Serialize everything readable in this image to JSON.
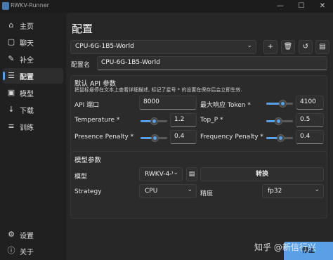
{
  "window": {
    "title": "RWKV-Runner",
    "controls": {
      "minimize": "—",
      "maximize": "☐",
      "close": "✕"
    }
  },
  "sidebar": {
    "items": [
      {
        "label": "主页",
        "icon": "home-icon",
        "glyph": "⌂"
      },
      {
        "label": "聊天",
        "icon": "chat-icon",
        "glyph": "▢"
      },
      {
        "label": "补全",
        "icon": "document-edit-icon",
        "glyph": "✎"
      },
      {
        "label": "配置",
        "icon": "sliders-icon",
        "glyph": "☰",
        "active": true
      },
      {
        "label": "模型",
        "icon": "model-icon",
        "glyph": "▣"
      },
      {
        "label": "下载",
        "icon": "download-icon",
        "glyph": "↓"
      },
      {
        "label": "训练",
        "icon": "training-icon",
        "glyph": "≡"
      }
    ],
    "bottom": [
      {
        "label": "设置",
        "icon": "gear-icon",
        "glyph": "⚙"
      },
      {
        "label": "关于",
        "icon": "info-icon",
        "glyph": "ⓘ"
      }
    ]
  },
  "page": {
    "title": "配置",
    "preset": "CPU-6G-1B5-World",
    "toolbar": {
      "add": "+",
      "delete": "🗑",
      "reset": "↺",
      "save": "▤"
    },
    "config_name_label": "配置名",
    "config_name_value": "CPU-6G-1B5-World"
  },
  "api": {
    "title": "默认 API 参数",
    "description": "把鼠标悬停在文本上查看详细描述, 标记了星号 * 的设置在保存后会立即生效.",
    "port": {
      "label": "API 端口",
      "value": "8000"
    },
    "max_tokens": {
      "label": "最大响应 Token *",
      "value": "4100",
      "fraction": 0.62
    },
    "temperature": {
      "label": "Temperature *",
      "value": "1.2",
      "fraction": 0.5
    },
    "top_p": {
      "label": "Top_P *",
      "value": "0.5",
      "fraction": 0.45
    },
    "presence_penalty": {
      "label": "Presence Penalty *",
      "value": "0.4",
      "fraction": 0.55
    },
    "frequency_penalty": {
      "label": "Frequency Penalty *",
      "value": "0.4",
      "fraction": 0.55
    }
  },
  "model": {
    "title": "模型参数",
    "model_label": "模型",
    "model_value": "RWKV-4-\\",
    "convert_button": "转换",
    "strategy_label": "Strategy",
    "strategy_value": "CPU",
    "precision_label": "精度",
    "precision_value": "fp32"
  },
  "run_button": "停止",
  "watermark": "知乎 @新信行兴"
}
